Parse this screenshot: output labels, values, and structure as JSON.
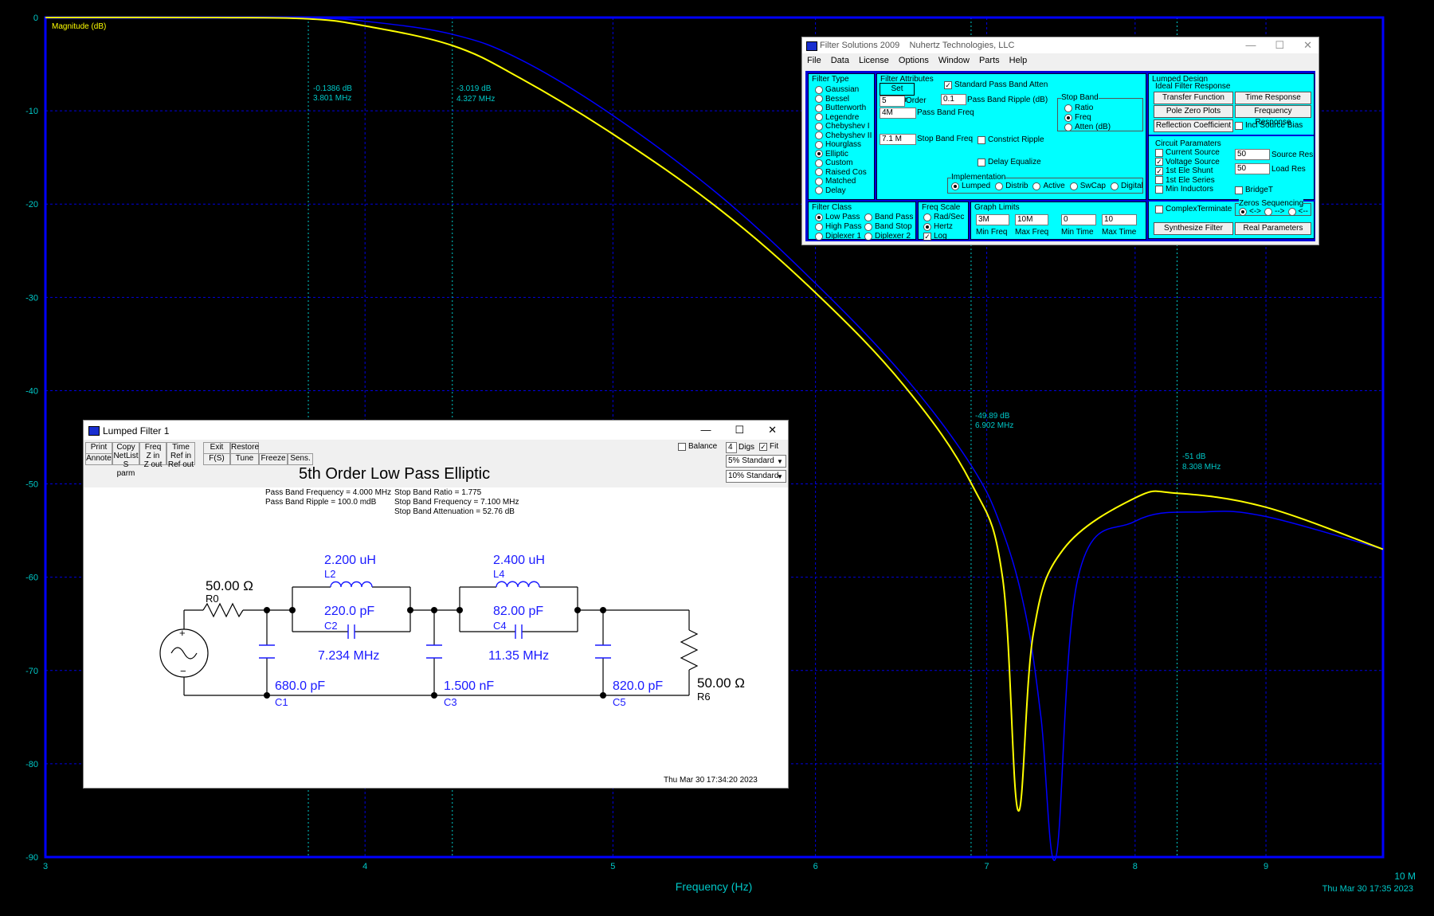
{
  "plot": {
    "y_axis_label": "Magnitude (dB)",
    "x_axis_label": "Frequency (Hz)",
    "y_ticks": [
      "0",
      "-10",
      "-20",
      "-30",
      "-40",
      "-50",
      "-60",
      "-70",
      "-80",
      "-90"
    ],
    "x_ticks": [
      "3",
      "4",
      "5",
      "6",
      "7",
      "8",
      "9"
    ],
    "x_end_label": "10 M",
    "timestamp": "Thu Mar 30 17:35 2023",
    "markers": [
      {
        "db": "-0.1386 dB",
        "freq": "3.801 MHz"
      },
      {
        "db": "-3.019 dB",
        "freq": "4.327 MHz"
      },
      {
        "db": "-49.89 dB",
        "freq": "6.902 MHz"
      },
      {
        "db": "-51 dB",
        "freq": "8.308 MHz"
      }
    ],
    "colors": {
      "grid": "#0000e0",
      "axis": "#0000ff",
      "primary_curve": "#ffff00",
      "secondary_curve": "#0000ff",
      "labels": "#00c8c8"
    }
  },
  "chart_data": {
    "type": "line",
    "title": "",
    "xlabel": "Frequency (Hz)",
    "ylabel": "Magnitude (dB)",
    "x_scale": "log",
    "xlim": [
      3000000,
      10000000
    ],
    "ylim": [
      -90,
      0
    ],
    "grid": true,
    "series": [
      {
        "color": "#ffff00",
        "x": [
          3000000,
          3500000,
          3801000,
          4000000,
          4327000,
          4600000,
          5000000,
          5500000,
          6000000,
          6500000,
          6902000,
          7100000,
          7200000,
          7300000,
          7500000,
          8000000,
          8308000,
          9000000,
          10000000
        ],
        "y": [
          0,
          0,
          -0.14,
          -0.9,
          -3.0,
          -6.5,
          -12.5,
          -20.5,
          -29.5,
          -39.5,
          -49.9,
          -60,
          -85,
          -66,
          -57,
          -51.5,
          -51,
          -52.5,
          -57
        ]
      },
      {
        "color": "#0000ff",
        "x": [
          3000000,
          3500000,
          3801000,
          4000000,
          4327000,
          4600000,
          5000000,
          5500000,
          6000000,
          6500000,
          6902000,
          7100000,
          7250000,
          7350000,
          7450000,
          7600000,
          8000000,
          8500000,
          9000000,
          10000000
        ],
        "y": [
          0,
          0,
          -0.05,
          -0.4,
          -1.8,
          -4.5,
          -10.5,
          -19,
          -28.5,
          -38.5,
          -48,
          -55,
          -64,
          -75,
          -90,
          -60,
          -54,
          -53,
          -53.5,
          -57
        ]
      }
    ]
  },
  "filter_solutions": {
    "title": "Filter Solutions 2009",
    "company": "Nuhertz Technologies, LLC",
    "menu": [
      "File",
      "Data",
      "License",
      "Options",
      "Window",
      "Parts",
      "Help"
    ],
    "filter_type": {
      "title": "Filter Type",
      "items": [
        "Gaussian",
        "Bessel",
        "Butterworth",
        "Legendre",
        "Chebyshev I",
        "Chebyshev II",
        "Hourglass",
        "Elliptic",
        "Custom",
        "Raised Cos",
        "Matched",
        "Delay"
      ],
      "selected": "Elliptic"
    },
    "attributes": {
      "title": "Filter Attributes",
      "set_order": "Set Order",
      "std_atten": "Standard Pass Band Atten",
      "order_value": "5",
      "order_label": "Order",
      "ripple_value": "0.1",
      "ripple_label": "Pass Band Ripple (dB)",
      "pbf_value": "4M",
      "pbf_label": "Pass Band Freq",
      "sbf_value": "7.1 M",
      "sbf_label": "Stop Band Freq",
      "constrict": "Constrict Ripple",
      "delay_eq": "Delay Equalize",
      "stop_band_title": "Stop Band",
      "stop_band_opts": [
        "Ratio",
        "Freq",
        "Atten (dB)"
      ],
      "impl_title": "Implementation",
      "impl_opts": [
        "Lumped",
        "Distrib",
        "Active",
        "SwCap",
        "Digital"
      ]
    },
    "filter_class": {
      "title": "Filter Class",
      "items": [
        "Low Pass",
        "Band Pass",
        "High Pass",
        "Band Stop",
        "Diplexer 1",
        "Diplexer 2"
      ]
    },
    "freq_scale": {
      "title": "Freq Scale",
      "items": [
        "Rad/Sec",
        "Hertz",
        "Log"
      ]
    },
    "graph_limits": {
      "title": "Graph Limits",
      "min_freq": "3M",
      "max_freq": "10M",
      "min_time": "0",
      "max_time": "10",
      "labels": [
        "Min Freq",
        "Max Freq",
        "Min Time",
        "Max Time"
      ]
    },
    "lumped_design": {
      "title": "Lumped Design",
      "ideal_title": "Ideal Filter Response",
      "buttons": [
        "Transfer Function",
        "Time Response",
        "Pole Zero Plots",
        "Frequency Response",
        "Reflection Coefficient"
      ],
      "incl_source": "Incl Source Bias",
      "circuit_title": "Circuit Paramaters",
      "checks": [
        "Current Source",
        "Voltage Source",
        "1st Ele Shunt",
        "1st Ele Series",
        "Min Inductors"
      ],
      "source_res": "50",
      "source_res_label": "Source Res",
      "load_res": "50",
      "load_res_label": "Load Res",
      "bridget": "BridgeT",
      "complex": "ComplexTerminate",
      "zeros_title": "Zeros Sequencing",
      "zeros_opts": [
        "<->",
        "-->",
        "<--"
      ],
      "synth": "Synthesize Filter",
      "real_params": "Real Parameters"
    }
  },
  "lumped_filter": {
    "title": "Lumped Filter 1",
    "toolbar": {
      "print": "Print",
      "annote": "Annote",
      "copy": "Copy",
      "netlist": "NetList",
      "sparm": "S parm",
      "freq": "Freq",
      "zin": "Z in",
      "zout": "Z out",
      "time": "Time",
      "refin": "Ref in",
      "refout": "Ref out",
      "exit": "Exit",
      "fs": "F(S)",
      "restore": "Restore",
      "tune": "Tune",
      "freeze": "Freeze",
      "sens": "Sens.",
      "balance": "Balance",
      "digs_value": "4",
      "digs_label": "Digs",
      "fit": "Fit",
      "tol1": "5% Standard",
      "tol2": "10% Standard"
    },
    "schematic_title": "5th Order Low Pass Elliptic",
    "specs_left": [
      "Pass Band Frequency = 4.000 MHz",
      "Pass Band Ripple = 100.0 mdB"
    ],
    "specs_right": [
      "Stop Band Ratio = 1.775",
      "Stop Band Frequency = 7.100 MHz",
      "Stop Band Attenuation = 52.76 dB"
    ],
    "components": {
      "r0_val": "50.00 Ω",
      "r0": "R0",
      "l2_val": "2.200 uH",
      "l2": "L2",
      "c2_val": "220.0 pF",
      "c2": "C2",
      "f2": "7.234 MHz",
      "l4_val": "2.400 uH",
      "l4": "L4",
      "c4_val": "82.00 pF",
      "c4": "C4",
      "f4": "11.35 MHz",
      "c1_val": "680.0 pF",
      "c1": "C1",
      "c3_val": "1.500 nF",
      "c3": "C3",
      "c5_val": "820.0 pF",
      "c5": "C5",
      "r6_val": "50.00 Ω",
      "r6": "R6"
    },
    "timestamp": "Thu Mar 30 17:34:20 2023"
  }
}
